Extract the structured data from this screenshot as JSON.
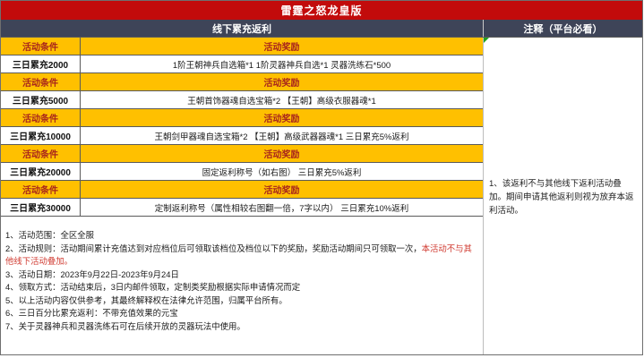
{
  "title": "雷霆之怒龙皇版",
  "sections": {
    "left_header": "线下累充返利",
    "right_header": "注释（平台必看）"
  },
  "table": {
    "condition_header": "活动条件",
    "reward_header": "活动奖励",
    "tiers": [
      {
        "condition": "三日累充2000",
        "reward": "1阶王朝神兵自选箱*1 1阶灵器神兵自选*1 灵器洗练石*500"
      },
      {
        "condition": "三日累充5000",
        "reward": "王朝首饰器魂自选宝箱*2 【王朝】高级衣服器魂*1"
      },
      {
        "condition": "三日累充10000",
        "reward": "王朝剑甲器魂自选宝箱*2 【王朝】高级武器器魂*1 三日累充5%返利"
      },
      {
        "condition": "三日累充20000",
        "reward": "固定返利称号（如右图） 三日累充5%返利"
      },
      {
        "condition": "三日累充30000",
        "reward": "定制返利称号（属性相较右图翻一倍，7字以内） 三日累充10%返利"
      }
    ]
  },
  "notes": [
    {
      "text": "1、活动范围：全区全服"
    },
    {
      "text": "2、活动规则：活动期间累计充值达到对应档位后可领取该档位及档位以下的奖励，奖励活动期间只可领取一次，",
      "red_text": "本活动不与其他线下活动叠加。"
    },
    {
      "text": "3、活动日期：2023年9月22日-2023年9月24日"
    },
    {
      "text": "4、领取方式：活动结束后，3日内邮件领取，定制类奖励根据实际申请情况而定"
    },
    {
      "text": "5、以上活动内容仅供参考，其最终解释权在法律允许范围，归属平台所有。"
    },
    {
      "text": "6、三日百分比累充返利：不带充值效果的元宝"
    },
    {
      "text": "7、关于灵器神兵和灵器洗练石可在后续开放的灵器玩法中使用。"
    }
  ],
  "annotation": "1、该返利不与其他线下返利活动叠加。期间申请其他返利则视为放弃本返利活动。",
  "colors": {
    "title_red": "#c20b0b",
    "header_navy": "#3e4458",
    "row_yellow": "#ffc000",
    "label_maroon": "#a8251c",
    "note_red": "#d03a30",
    "marker_green": "#1f9f1f"
  }
}
